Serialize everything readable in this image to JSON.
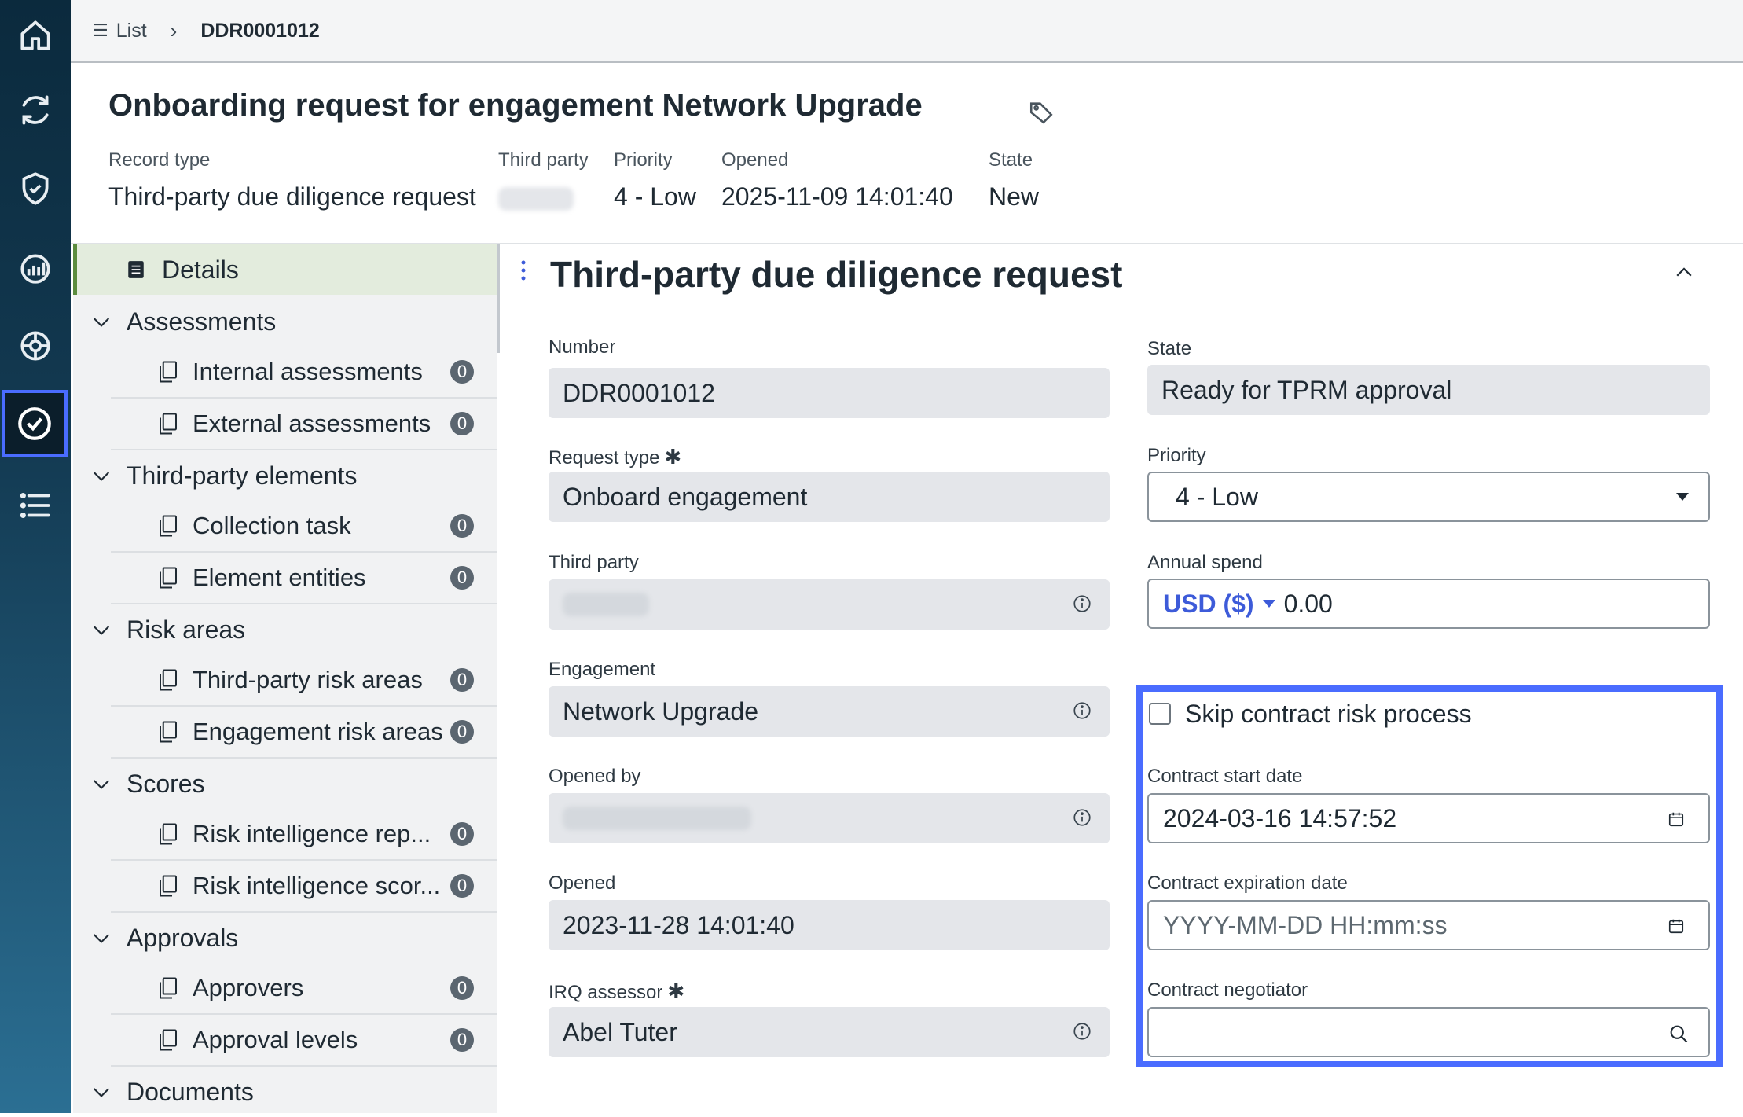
{
  "breadcrumb": {
    "list_label": "List",
    "current": "DDR0001012"
  },
  "record": {
    "title": "Onboarding request for engagement Network Upgrade",
    "meta": [
      {
        "label": "Record type",
        "value": "Third-party due diligence request"
      },
      {
        "label": "Third party",
        "value": ""
      },
      {
        "label": "Priority",
        "value": "4 - Low"
      },
      {
        "label": "Opened",
        "value": "2025-11-09 14:01:40"
      },
      {
        "label": "State",
        "value": "New"
      }
    ]
  },
  "nav": {
    "details": "Details",
    "groups": [
      {
        "label": "Assessments",
        "items": [
          {
            "label": "Internal assessments",
            "count": "0"
          },
          {
            "label": "External assessments",
            "count": "0"
          }
        ]
      },
      {
        "label": "Third-party elements",
        "items": [
          {
            "label": "Collection task",
            "count": "0"
          },
          {
            "label": "Element entities",
            "count": "0"
          }
        ]
      },
      {
        "label": "Risk areas",
        "items": [
          {
            "label": "Third-party risk areas",
            "count": "0"
          },
          {
            "label": "Engagement risk areas",
            "count": "0"
          }
        ]
      },
      {
        "label": "Scores",
        "items": [
          {
            "label": "Risk intelligence rep...",
            "count": "0"
          },
          {
            "label": "Risk intelligence scor...",
            "count": "0"
          }
        ]
      },
      {
        "label": "Approvals",
        "items": [
          {
            "label": "Approvers",
            "count": "0"
          },
          {
            "label": "Approval levels",
            "count": "0"
          }
        ]
      },
      {
        "label": "Documents",
        "items": []
      }
    ]
  },
  "form": {
    "title": "Third-party due diligence request",
    "number": {
      "label": "Number",
      "value": "DDR0001012"
    },
    "request_type": {
      "label": "Request type",
      "required": "✱",
      "value": "Onboard engagement"
    },
    "third_party": {
      "label": "Third party",
      "value": ""
    },
    "engagement": {
      "label": "Engagement",
      "value": "Network Upgrade"
    },
    "opened_by": {
      "label": "Opened by",
      "value": ""
    },
    "opened": {
      "label": "Opened",
      "value": "2023-11-28 14:01:40"
    },
    "irq_assessor": {
      "label": "IRQ assessor",
      "required": "✱",
      "value": "Abel Tuter"
    },
    "state": {
      "label": "State",
      "value": "Ready for TPRM approval"
    },
    "priority": {
      "label": "Priority",
      "value": "4 - Low"
    },
    "annual_spend": {
      "label": "Annual spend",
      "currency": "USD ($)",
      "value": "0.00"
    },
    "skip_contract": {
      "label": "Skip contract risk process",
      "checked": false
    },
    "contract_start": {
      "label": "Contract start date",
      "value": "2024-03-16 14:57:52"
    },
    "contract_expiration": {
      "label": "Contract expiration date",
      "placeholder": "YYYY-MM-DD HH:mm:ss"
    },
    "contract_negotiator": {
      "label": "Contract negotiator",
      "value": ""
    }
  },
  "colors": {
    "accent": "#4a6cff",
    "rail_top": "#0b2a3d",
    "rail_bottom": "#2b6f93",
    "currency": "#3d5bd9",
    "details_bar": "#5b8c3e"
  },
  "icons": [
    "home-icon",
    "refresh-icon",
    "shield-check-icon",
    "dashboard-gauge-icon",
    "risk-wheel-icon",
    "check-circle-icon",
    "list-icon",
    "tag-icon",
    "info-icon",
    "calendar-icon",
    "search-icon"
  ]
}
